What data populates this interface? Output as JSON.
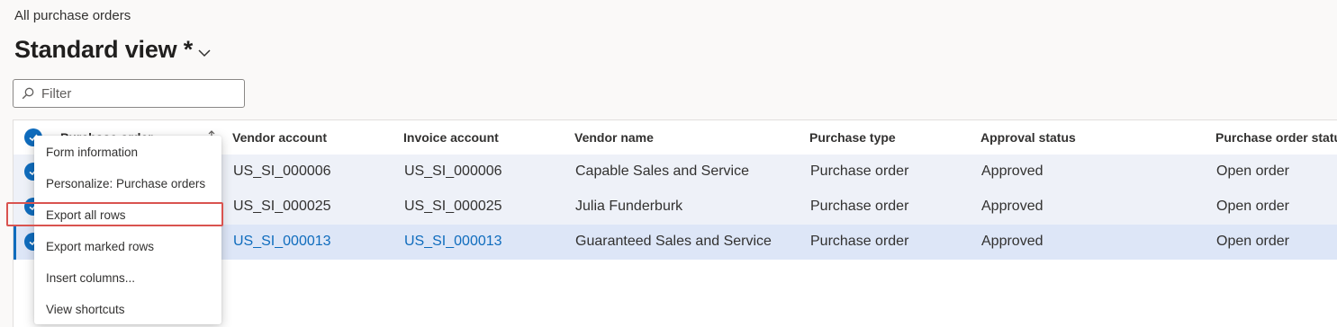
{
  "breadcrumb": "All purchase orders",
  "view": {
    "title": "Standard view *"
  },
  "filter": {
    "placeholder": "Filter",
    "value": ""
  },
  "grid": {
    "columns": [
      "Purchase order",
      "Vendor account",
      "Invoice account",
      "Vendor name",
      "Purchase type",
      "Approval status",
      "Purchase order status"
    ],
    "rows": [
      {
        "vendor_account": "US_SI_000006",
        "invoice_account": "US_SI_000006",
        "vendor_name": "Capable Sales and Service",
        "purchase_type": "Purchase order",
        "approval_status": "Approved",
        "po_status": "Open order"
      },
      {
        "vendor_account": "US_SI_000025",
        "invoice_account": "US_SI_000025",
        "vendor_name": "Julia Funderburk",
        "purchase_type": "Purchase order",
        "approval_status": "Approved",
        "po_status": "Open order"
      },
      {
        "vendor_account": "US_SI_000013",
        "invoice_account": "US_SI_000013",
        "vendor_name": "Guaranteed Sales and Service",
        "purchase_type": "Purchase order",
        "approval_status": "Approved",
        "po_status": "Open order"
      }
    ]
  },
  "context_menu": {
    "items": [
      "Form information",
      "Personalize: Purchase orders",
      "Export all rows",
      "Export marked rows",
      "Insert columns...",
      "View shortcuts"
    ],
    "highlighted_item": "Export all rows"
  },
  "colors": {
    "accent": "#0f6cbd",
    "row_selected": "#eef1f8",
    "row_active": "#dde6f7",
    "highlight": "#d9534f"
  },
  "icons": [
    "chevron-down-icon",
    "search-icon",
    "checkmark-icon",
    "sort-icon"
  ]
}
